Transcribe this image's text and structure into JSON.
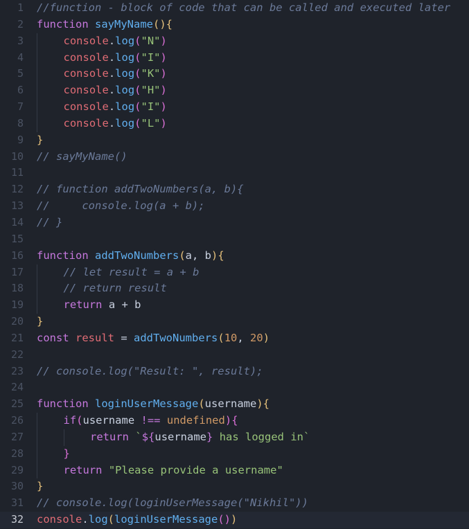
{
  "editor": {
    "active_line": 32,
    "lines": [
      {
        "n": "1",
        "tokens": [
          {
            "t": "cm",
            "v": "//function - block of code that can be called and executed later"
          }
        ]
      },
      {
        "n": "2",
        "tokens": [
          {
            "t": "kw",
            "v": "function"
          },
          {
            "t": "plain",
            "v": " "
          },
          {
            "t": "fn",
            "v": "sayMyName"
          },
          {
            "t": "br",
            "v": "()"
          },
          {
            "t": "br",
            "v": "{"
          }
        ]
      },
      {
        "n": "3",
        "indent": 1,
        "tokens": [
          {
            "t": "obj",
            "v": "console"
          },
          {
            "t": "plain",
            "v": "."
          },
          {
            "t": "fn",
            "v": "log"
          },
          {
            "t": "br2",
            "v": "("
          },
          {
            "t": "str",
            "v": "\"N\""
          },
          {
            "t": "br2",
            "v": ")"
          }
        ]
      },
      {
        "n": "4",
        "indent": 1,
        "tokens": [
          {
            "t": "obj",
            "v": "console"
          },
          {
            "t": "plain",
            "v": "."
          },
          {
            "t": "fn",
            "v": "log"
          },
          {
            "t": "br2",
            "v": "("
          },
          {
            "t": "str",
            "v": "\"I\""
          },
          {
            "t": "br2",
            "v": ")"
          }
        ]
      },
      {
        "n": "5",
        "indent": 1,
        "tokens": [
          {
            "t": "obj",
            "v": "console"
          },
          {
            "t": "plain",
            "v": "."
          },
          {
            "t": "fn",
            "v": "log"
          },
          {
            "t": "br2",
            "v": "("
          },
          {
            "t": "str",
            "v": "\"K\""
          },
          {
            "t": "br2",
            "v": ")"
          }
        ]
      },
      {
        "n": "6",
        "indent": 1,
        "tokens": [
          {
            "t": "obj",
            "v": "console"
          },
          {
            "t": "plain",
            "v": "."
          },
          {
            "t": "fn",
            "v": "log"
          },
          {
            "t": "br2",
            "v": "("
          },
          {
            "t": "str",
            "v": "\"H\""
          },
          {
            "t": "br2",
            "v": ")"
          }
        ]
      },
      {
        "n": "7",
        "indent": 1,
        "tokens": [
          {
            "t": "obj",
            "v": "console"
          },
          {
            "t": "plain",
            "v": "."
          },
          {
            "t": "fn",
            "v": "log"
          },
          {
            "t": "br2",
            "v": "("
          },
          {
            "t": "str",
            "v": "\"I\""
          },
          {
            "t": "br2",
            "v": ")"
          }
        ]
      },
      {
        "n": "8",
        "indent": 1,
        "tokens": [
          {
            "t": "obj",
            "v": "console"
          },
          {
            "t": "plain",
            "v": "."
          },
          {
            "t": "fn",
            "v": "log"
          },
          {
            "t": "br2",
            "v": "("
          },
          {
            "t": "str",
            "v": "\"L\""
          },
          {
            "t": "br2",
            "v": ")"
          }
        ]
      },
      {
        "n": "9",
        "tokens": [
          {
            "t": "br",
            "v": "}"
          }
        ]
      },
      {
        "n": "10",
        "tokens": [
          {
            "t": "cm",
            "v": "// sayMyName()"
          }
        ]
      },
      {
        "n": "11",
        "tokens": []
      },
      {
        "n": "12",
        "tokens": [
          {
            "t": "cm",
            "v": "// function addTwoNumbers(a, b){"
          }
        ]
      },
      {
        "n": "13",
        "tokens": [
          {
            "t": "cm",
            "v": "//     console.log(a + b);"
          }
        ]
      },
      {
        "n": "14",
        "tokens": [
          {
            "t": "cm",
            "v": "// }"
          }
        ]
      },
      {
        "n": "15",
        "tokens": []
      },
      {
        "n": "16",
        "tokens": [
          {
            "t": "kw",
            "v": "function"
          },
          {
            "t": "plain",
            "v": " "
          },
          {
            "t": "fn",
            "v": "addTwoNumbers"
          },
          {
            "t": "br",
            "v": "("
          },
          {
            "t": "plain",
            "v": "a, b"
          },
          {
            "t": "br",
            "v": ")"
          },
          {
            "t": "br",
            "v": "{"
          }
        ]
      },
      {
        "n": "17",
        "indent": 1,
        "tokens": [
          {
            "t": "cm",
            "v": "// let result = a + b"
          }
        ]
      },
      {
        "n": "18",
        "indent": 1,
        "tokens": [
          {
            "t": "cm",
            "v": "// return result"
          }
        ]
      },
      {
        "n": "19",
        "indent": 1,
        "tokens": [
          {
            "t": "kw",
            "v": "return"
          },
          {
            "t": "plain",
            "v": " a + b"
          }
        ]
      },
      {
        "n": "20",
        "tokens": [
          {
            "t": "br",
            "v": "}"
          }
        ]
      },
      {
        "n": "21",
        "tokens": [
          {
            "t": "kw",
            "v": "const"
          },
          {
            "t": "plain",
            "v": " "
          },
          {
            "t": "obj",
            "v": "result"
          },
          {
            "t": "plain",
            "v": " = "
          },
          {
            "t": "fn",
            "v": "addTwoNumbers"
          },
          {
            "t": "br",
            "v": "("
          },
          {
            "t": "num",
            "v": "10"
          },
          {
            "t": "plain",
            "v": ", "
          },
          {
            "t": "num",
            "v": "20"
          },
          {
            "t": "br",
            "v": ")"
          }
        ]
      },
      {
        "n": "22",
        "tokens": []
      },
      {
        "n": "23",
        "tokens": [
          {
            "t": "cm",
            "v": "// console.log(\"Result: \", result);"
          }
        ]
      },
      {
        "n": "24",
        "tokens": []
      },
      {
        "n": "25",
        "tokens": [
          {
            "t": "kw",
            "v": "function"
          },
          {
            "t": "plain",
            "v": " "
          },
          {
            "t": "fn",
            "v": "loginUserMessage"
          },
          {
            "t": "br",
            "v": "("
          },
          {
            "t": "plain",
            "v": "username"
          },
          {
            "t": "br",
            "v": ")"
          },
          {
            "t": "br",
            "v": "{"
          }
        ]
      },
      {
        "n": "26",
        "indent": 1,
        "tokens": [
          {
            "t": "kw",
            "v": "if"
          },
          {
            "t": "br2",
            "v": "("
          },
          {
            "t": "plain",
            "v": "username "
          },
          {
            "t": "kw",
            "v": "!=="
          },
          {
            "t": "plain",
            "v": " "
          },
          {
            "t": "undef",
            "v": "undefined"
          },
          {
            "t": "br2",
            "v": ")"
          },
          {
            "t": "br2",
            "v": "{"
          }
        ]
      },
      {
        "n": "27",
        "indent": 2,
        "tokens": [
          {
            "t": "kw",
            "v": "return"
          },
          {
            "t": "plain",
            "v": " "
          },
          {
            "t": "str",
            "v": "`"
          },
          {
            "t": "kw",
            "v": "${"
          },
          {
            "t": "plain",
            "v": "username"
          },
          {
            "t": "kw",
            "v": "}"
          },
          {
            "t": "str",
            "v": " has logged in`"
          }
        ]
      },
      {
        "n": "28",
        "indent": 1,
        "tokens": [
          {
            "t": "br2",
            "v": "}"
          }
        ]
      },
      {
        "n": "29",
        "indent": 1,
        "tokens": [
          {
            "t": "kw",
            "v": "return"
          },
          {
            "t": "plain",
            "v": " "
          },
          {
            "t": "str",
            "v": "\"Please provide a username\""
          }
        ]
      },
      {
        "n": "30",
        "tokens": [
          {
            "t": "br",
            "v": "}"
          }
        ]
      },
      {
        "n": "31",
        "tokens": [
          {
            "t": "cm",
            "v": "// console.log(loginUserMessage(\"Nikhil\"))"
          }
        ]
      },
      {
        "n": "32",
        "tokens": [
          {
            "t": "obj",
            "v": "console"
          },
          {
            "t": "plain",
            "v": "."
          },
          {
            "t": "fn",
            "v": "log"
          },
          {
            "t": "br",
            "v": "("
          },
          {
            "t": "fn",
            "v": "loginUserMessage"
          },
          {
            "t": "br2",
            "v": "()"
          },
          {
            "t": "br",
            "v": ")"
          }
        ]
      }
    ]
  }
}
